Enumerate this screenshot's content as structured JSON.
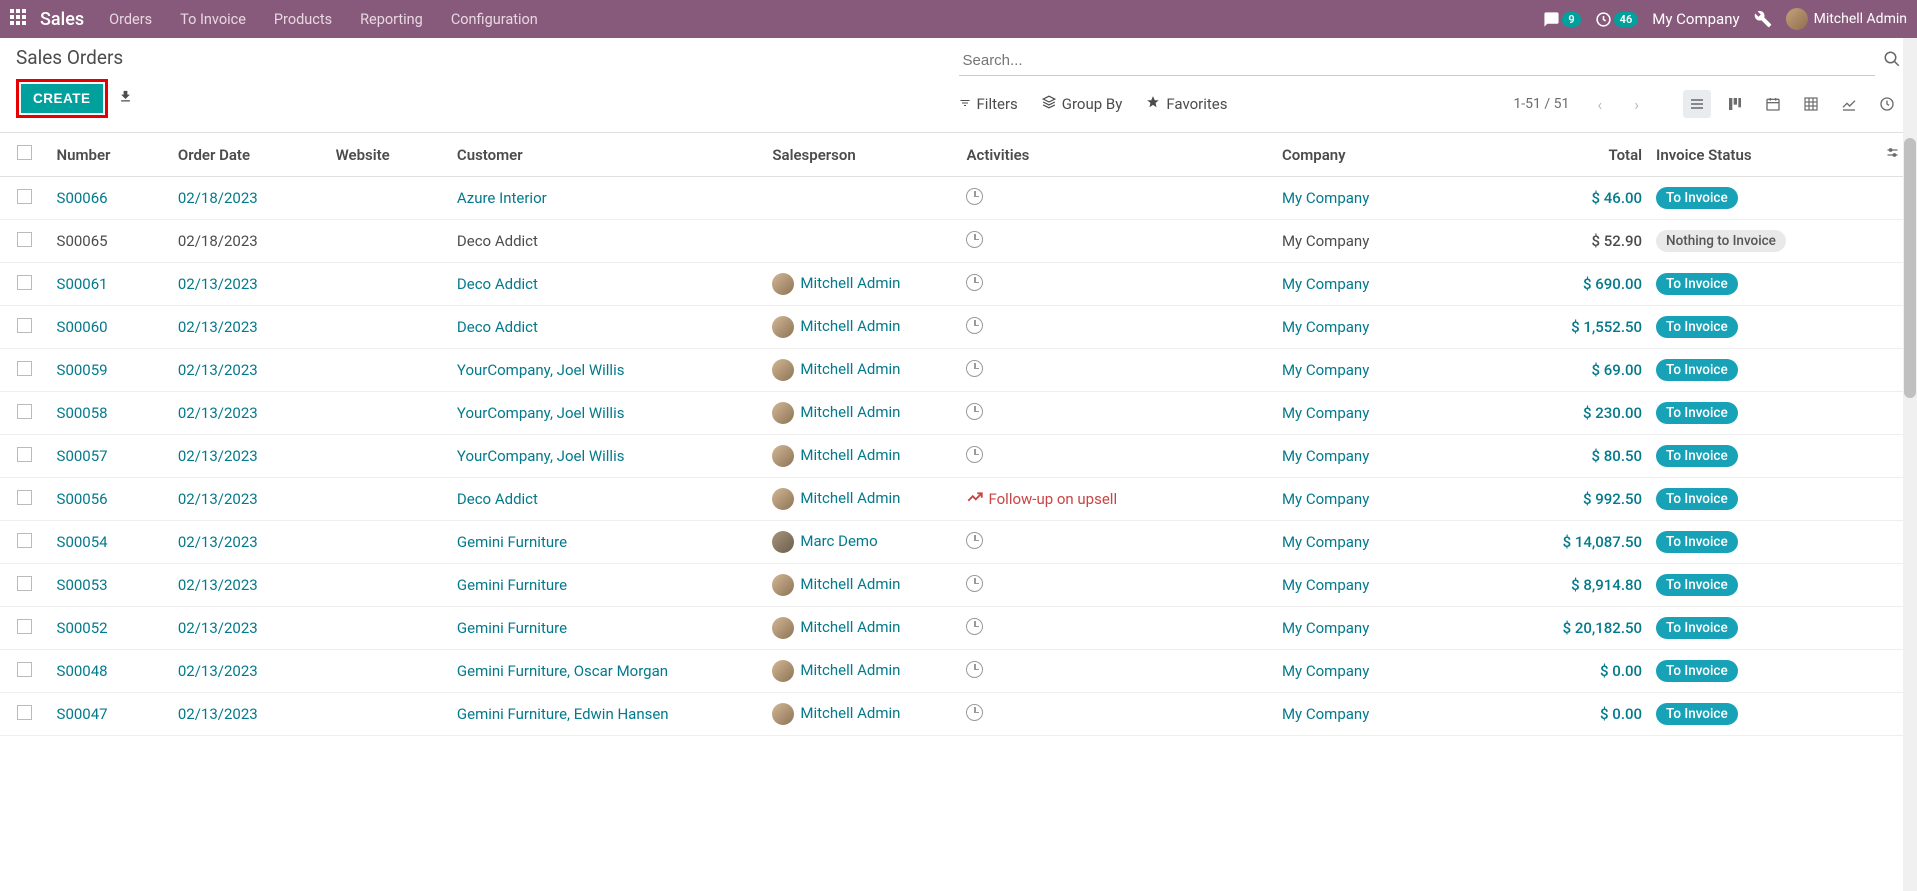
{
  "nav": {
    "brand": "Sales",
    "menu": [
      "Orders",
      "To Invoice",
      "Products",
      "Reporting",
      "Configuration"
    ],
    "discuss_count": "9",
    "activity_count": "46",
    "company": "My Company",
    "user": "Mitchell Admin"
  },
  "header": {
    "title": "Sales Orders",
    "create": "CREATE",
    "search_placeholder": "Search...",
    "filters": "Filters",
    "groupby": "Group By",
    "favorites": "Favorites",
    "pager": "1-51 / 51"
  },
  "columns": {
    "number": "Number",
    "order_date": "Order Date",
    "website": "Website",
    "customer": "Customer",
    "salesperson": "Salesperson",
    "activities": "Activities",
    "company": "Company",
    "total": "Total",
    "invoice_status": "Invoice Status"
  },
  "status_labels": {
    "to_invoice": "To Invoice",
    "nothing": "Nothing to Invoice"
  },
  "activity_label": "Follow-up on upsell",
  "rows": [
    {
      "number": "S00066",
      "date": "02/18/2023",
      "customer": "Azure Interior",
      "salesperson": "",
      "sp_type": "",
      "activity": "clock",
      "company": "My Company",
      "total": "$ 46.00",
      "status": "to_invoice",
      "active": true
    },
    {
      "number": "S00065",
      "date": "02/18/2023",
      "customer": "Deco Addict",
      "salesperson": "",
      "sp_type": "",
      "activity": "clock",
      "company": "My Company",
      "total": "$ 52.90",
      "status": "nothing",
      "active": false
    },
    {
      "number": "S00061",
      "date": "02/13/2023",
      "customer": "Deco Addict",
      "salesperson": "Mitchell Admin",
      "sp_type": "mitchell",
      "activity": "clock",
      "company": "My Company",
      "total": "$ 690.00",
      "status": "to_invoice",
      "active": true
    },
    {
      "number": "S00060",
      "date": "02/13/2023",
      "customer": "Deco Addict",
      "salesperson": "Mitchell Admin",
      "sp_type": "mitchell",
      "activity": "clock",
      "company": "My Company",
      "total": "$ 1,552.50",
      "status": "to_invoice",
      "active": true
    },
    {
      "number": "S00059",
      "date": "02/13/2023",
      "customer": "YourCompany, Joel Willis",
      "salesperson": "Mitchell Admin",
      "sp_type": "mitchell",
      "activity": "clock",
      "company": "My Company",
      "total": "$ 69.00",
      "status": "to_invoice",
      "active": true
    },
    {
      "number": "S00058",
      "date": "02/13/2023",
      "customer": "YourCompany, Joel Willis",
      "salesperson": "Mitchell Admin",
      "sp_type": "mitchell",
      "activity": "clock",
      "company": "My Company",
      "total": "$ 230.00",
      "status": "to_invoice",
      "active": true
    },
    {
      "number": "S00057",
      "date": "02/13/2023",
      "customer": "YourCompany, Joel Willis",
      "salesperson": "Mitchell Admin",
      "sp_type": "mitchell",
      "activity": "clock",
      "company": "My Company",
      "total": "$ 80.50",
      "status": "to_invoice",
      "active": true
    },
    {
      "number": "S00056",
      "date": "02/13/2023",
      "customer": "Deco Addict",
      "salesperson": "Mitchell Admin",
      "sp_type": "mitchell",
      "activity": "followup",
      "company": "My Company",
      "total": "$ 992.50",
      "status": "to_invoice",
      "active": true
    },
    {
      "number": "S00054",
      "date": "02/13/2023",
      "customer": "Gemini Furniture",
      "salesperson": "Marc Demo",
      "sp_type": "marc",
      "activity": "clock",
      "company": "My Company",
      "total": "$ 14,087.50",
      "status": "to_invoice",
      "active": true
    },
    {
      "number": "S00053",
      "date": "02/13/2023",
      "customer": "Gemini Furniture",
      "salesperson": "Mitchell Admin",
      "sp_type": "mitchell",
      "activity": "clock",
      "company": "My Company",
      "total": "$ 8,914.80",
      "status": "to_invoice",
      "active": true
    },
    {
      "number": "S00052",
      "date": "02/13/2023",
      "customer": "Gemini Furniture",
      "salesperson": "Mitchell Admin",
      "sp_type": "mitchell",
      "activity": "clock",
      "company": "My Company",
      "total": "$ 20,182.50",
      "status": "to_invoice",
      "active": true
    },
    {
      "number": "S00048",
      "date": "02/13/2023",
      "customer": "Gemini Furniture, Oscar Morgan",
      "salesperson": "Mitchell Admin",
      "sp_type": "mitchell",
      "activity": "clock",
      "company": "My Company",
      "total": "$ 0.00",
      "status": "to_invoice",
      "active": true
    },
    {
      "number": "S00047",
      "date": "02/13/2023",
      "customer": "Gemini Furniture, Edwin Hansen",
      "salesperson": "Mitchell Admin",
      "sp_type": "mitchell",
      "activity": "clock",
      "company": "My Company",
      "total": "$ 0.00",
      "status": "to_invoice",
      "active": true
    }
  ]
}
